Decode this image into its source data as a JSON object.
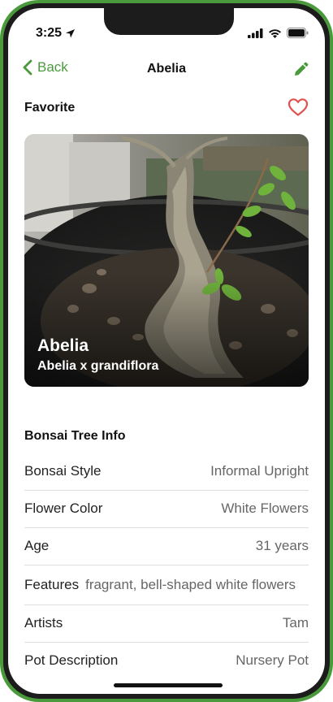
{
  "status_bar": {
    "time": "3:25"
  },
  "nav": {
    "back_label": "Back",
    "title": "Abelia"
  },
  "favorite": {
    "label": "Favorite",
    "is_favorite": false
  },
  "hero": {
    "common_name": "Abelia",
    "scientific_name": "Abelia x grandiflora"
  },
  "info": {
    "section_title": "Bonsai Tree Info",
    "rows": [
      {
        "key": "Bonsai Style",
        "value": "Informal Upright"
      },
      {
        "key": "Flower Color",
        "value": "White Flowers"
      },
      {
        "key": "Age",
        "value": "31 years"
      },
      {
        "key": "Features",
        "value": "fragrant, bell-shaped white flowers"
      },
      {
        "key": "Artists",
        "value": "Tam"
      },
      {
        "key": "Pot Description",
        "value": "Nursery Pot"
      }
    ]
  },
  "colors": {
    "accent": "#4a9a3c",
    "heart": "#e0504f",
    "text_secondary": "#666666"
  }
}
